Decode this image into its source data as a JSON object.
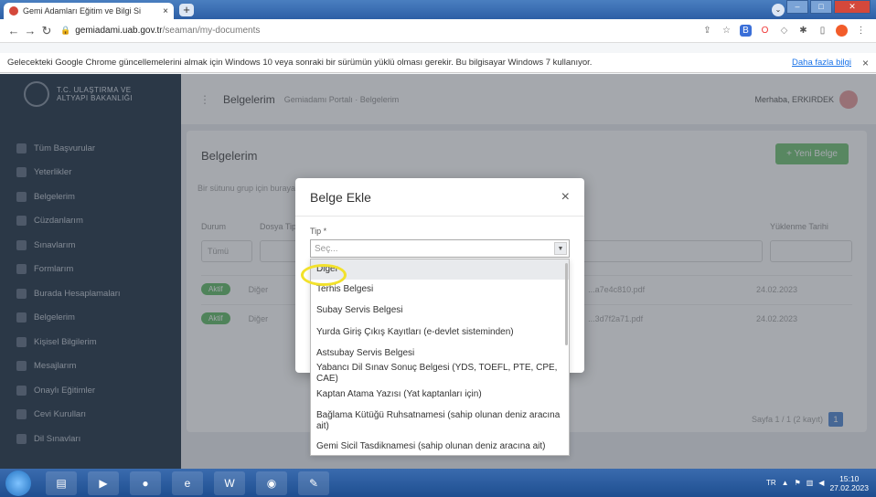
{
  "browser": {
    "tab_title": "Gemi Adamları Eğitim ve Bilgi Si",
    "tab_close": "×",
    "new_tab": "+",
    "url_host": "gemiadami.uab.gov.tr",
    "url_path": "/seaman/my-documents"
  },
  "infobar": {
    "message": "Gelecekteki Google Chrome güncellemelerini almak için Windows 10 veya sonraki bir sürümün yüklü olması gerekir. Bu bilgisayar Windows 7 kullanıyor.",
    "link": "Daha fazla bilgi",
    "close": "×"
  },
  "sidebar": {
    "logo_line1": "T.C. ULAŞTIRMA VE",
    "logo_line2": "ALTYAPI BAKANLIĞI",
    "items": [
      {
        "label": "Tüm Başvurular"
      },
      {
        "label": "Yeterlikler"
      },
      {
        "label": "Belgelerim"
      },
      {
        "label": "Cüzdanlarım"
      },
      {
        "label": "Sınavlarım"
      },
      {
        "label": "Formlarım"
      },
      {
        "label": "Burada Hesaplamaları"
      },
      {
        "label": "Belgelerim"
      },
      {
        "label": "Kişisel Bilgilerim"
      },
      {
        "label": "Mesajlarım"
      },
      {
        "label": "Onaylı Eğitimler"
      },
      {
        "label": "Cevi Kurulları"
      },
      {
        "label": "Dil Sınavları"
      }
    ]
  },
  "main": {
    "title": "Belgelerim",
    "breadcrumb": "Gemiadamı Portalı · Belgelerim",
    "user": "Merhaba, ERKIRDEK",
    "card_title": "Belgelerim",
    "new_button": "+ Yeni Belge",
    "search_placeholder": "Bir sütunu grup için buraya sürükleyin",
    "col_status": "Durum",
    "col_type": "Dosya Tipi",
    "col_date": "Yüklenme Tarihi",
    "filter_status": "Tümü",
    "rows": [
      {
        "badge": "Aktif",
        "type": "Diğer",
        "file": "...a7e4c810.pdf",
        "date": "24.02.2023"
      },
      {
        "badge": "Aktif",
        "type": "Diğer",
        "file": "...3d7f2a71.pdf",
        "date": "24.02.2023"
      }
    ],
    "pager": "Sayfa 1 / 1 (2 kayıt)",
    "page": "1"
  },
  "modal": {
    "title": "Belge Ekle",
    "close": "×",
    "field_label": "Tip *",
    "select_placeholder": "Seç..."
  },
  "dropdown": {
    "options": [
      {
        "label": "Diğer",
        "selected": true
      },
      {
        "label": "Terhis Belgesi"
      },
      {
        "label": "Subay Servis Belgesi"
      },
      {
        "label": "Yurda Giriş Çıkış Kayıtları (e-devlet sisteminden)"
      },
      {
        "label": "Astsubay Servis Belgesi"
      },
      {
        "label": "Yabancı Dil Sınav Sonuç Belgesi (YDS, TOEFL, PTE, CPE, CAE)"
      },
      {
        "label": "Kaptan Atama Yazısı (Yat kaptanları için)"
      },
      {
        "label": "Bağlama Kütüğü Ruhsatnamesi (sahip olunan deniz aracına ait)"
      },
      {
        "label": "Gemi Sicil Tasdiknamesi (sahip olunan deniz aracına ait)"
      }
    ]
  },
  "taskbar": {
    "lang": "TR",
    "time": "15:10",
    "date": "27.02.2023"
  },
  "colors": {
    "sidebar_bg": "#2d3e50",
    "accent_green": "#6cc070",
    "highlight_ring": "#f2e12b",
    "taskbar": "#2a5a9e"
  }
}
